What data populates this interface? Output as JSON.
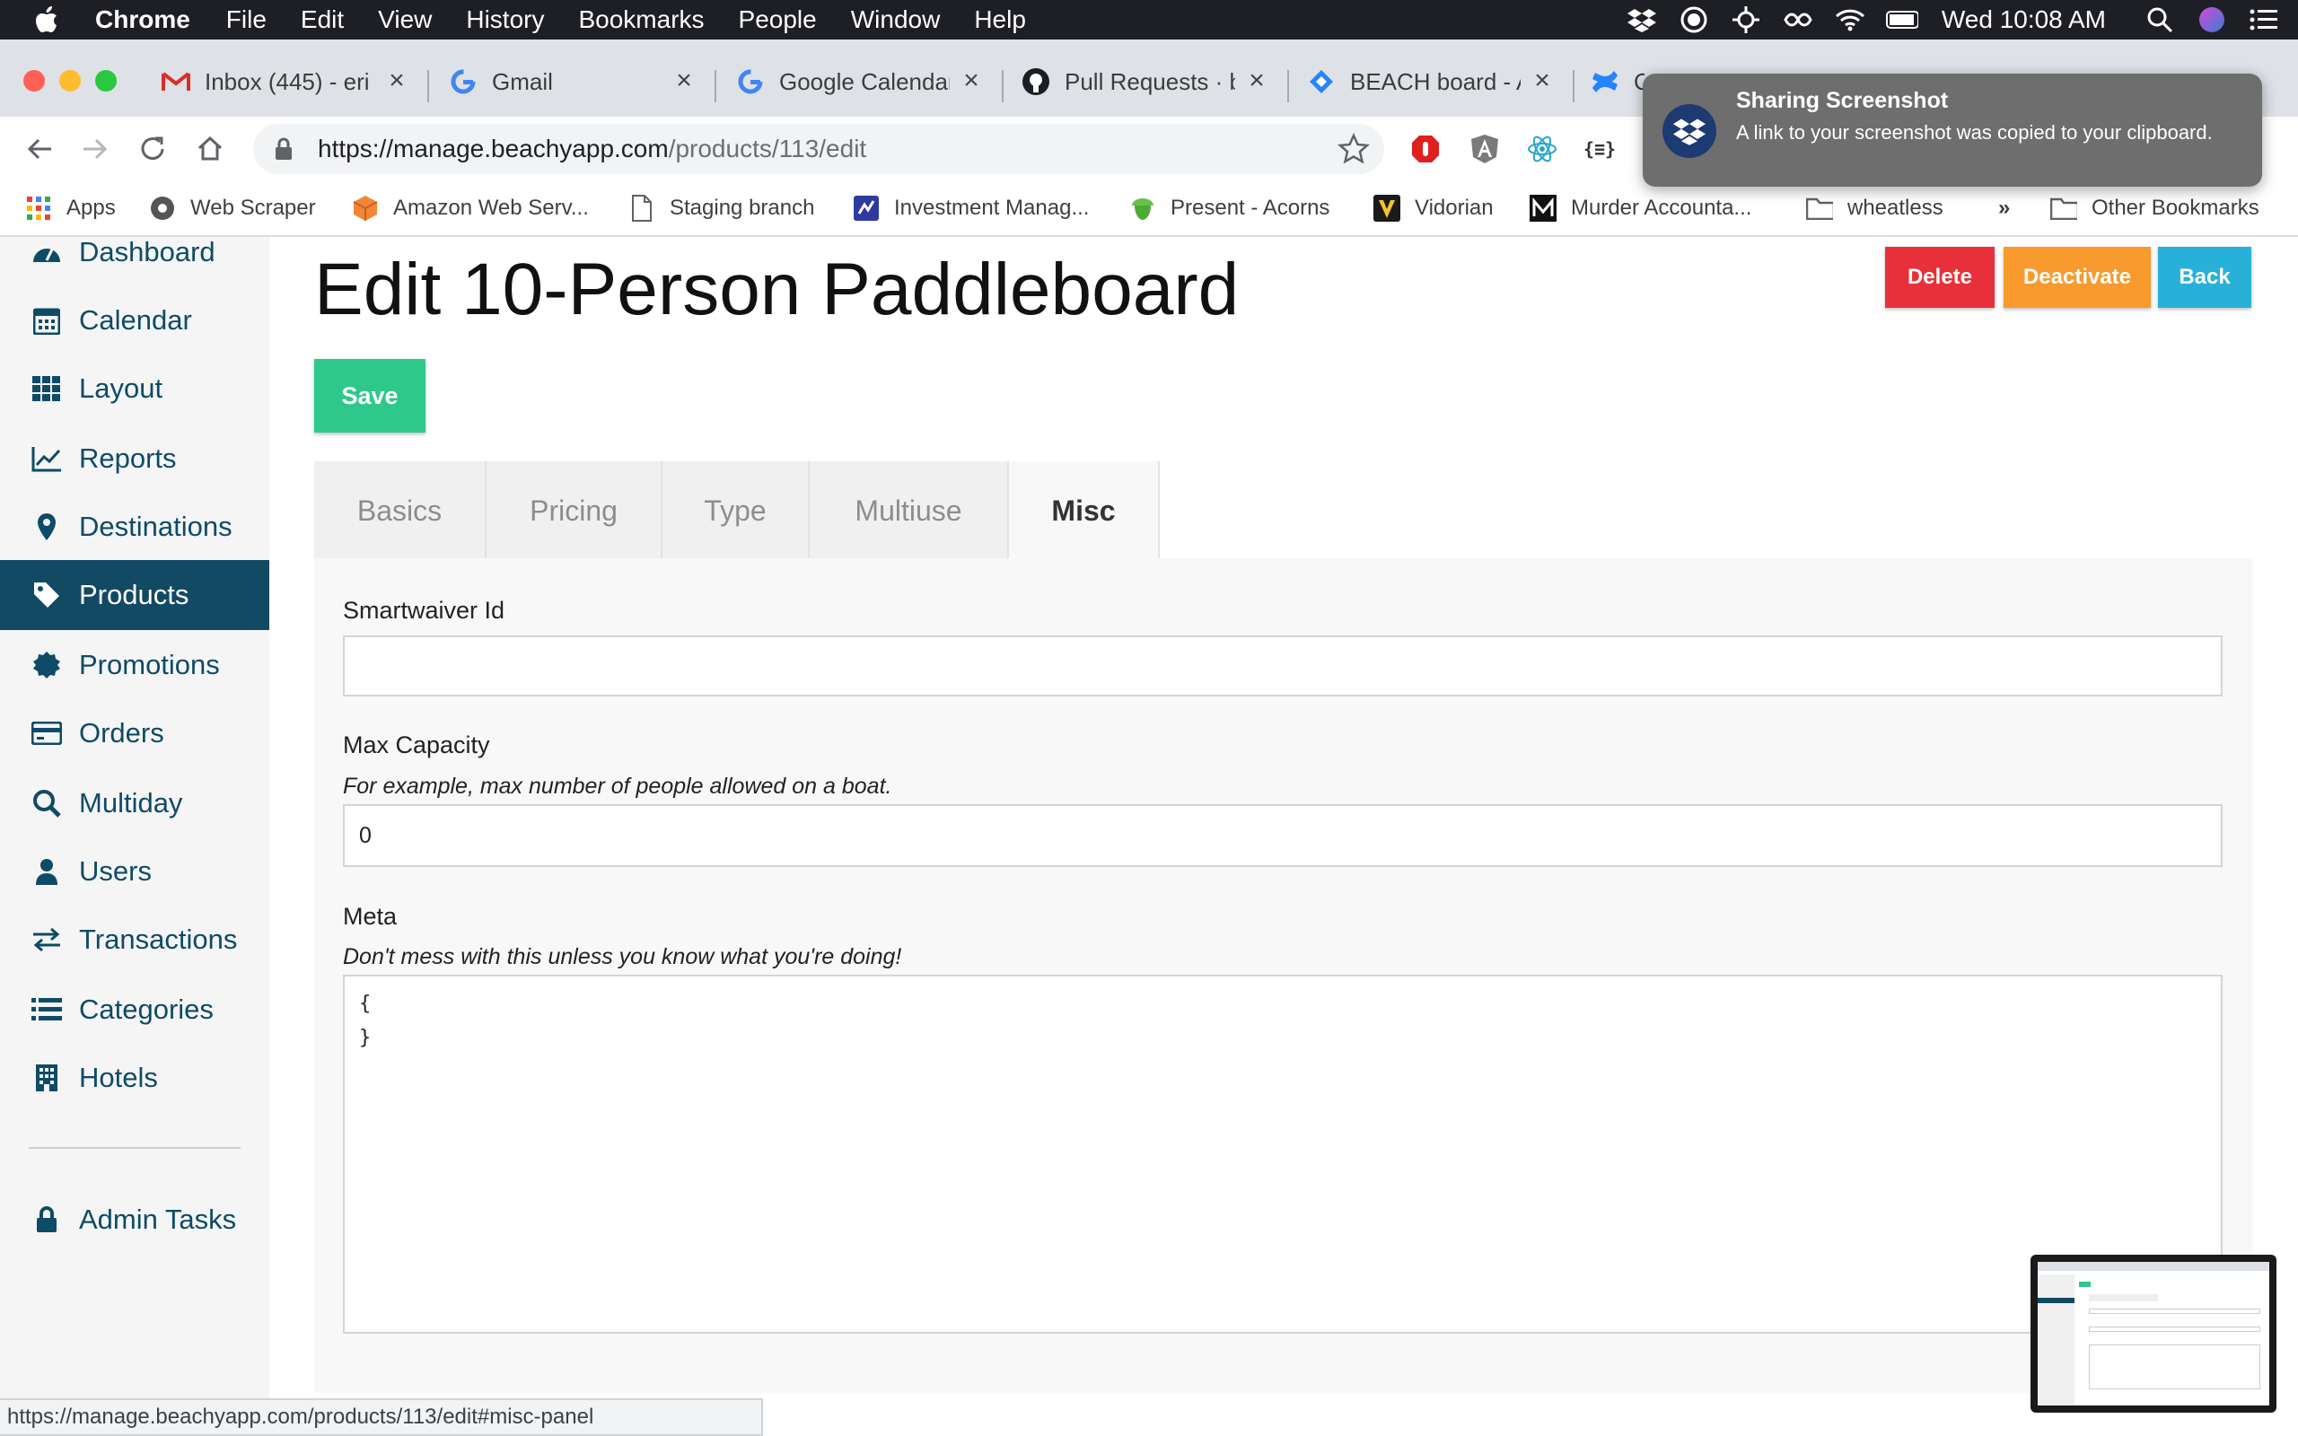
{
  "menubar": {
    "app_name": "Chrome",
    "items": [
      "File",
      "Edit",
      "View",
      "History",
      "Bookmarks",
      "People",
      "Window",
      "Help"
    ],
    "clock": "Wed 10:08 AM"
  },
  "tabs": [
    {
      "title": "Inbox (445) - eri",
      "icon": "gmail-icon"
    },
    {
      "title": "Gmail",
      "icon": "google-icon"
    },
    {
      "title": "Google Calendar",
      "icon": "google-icon"
    },
    {
      "title": "Pull Requests · b",
      "icon": "github-icon"
    },
    {
      "title": "BEACH board - A",
      "icon": "jira-icon"
    },
    {
      "title": "C",
      "icon": "confluence-icon"
    }
  ],
  "address": {
    "host": "https://manage.beachyapp.com",
    "path": "/products/113/edit"
  },
  "bookmarks": [
    "Apps",
    "Web Scraper",
    "Amazon Web Serv...",
    "Staging branch",
    "Investment Manag...",
    "Present - Acorns",
    "Vidorian",
    "Murder Accounta...",
    "wheatless",
    "»",
    "Other Bookmarks"
  ],
  "sidebar": {
    "items": [
      {
        "label": "Dashboard",
        "icon": "dashboard-icon"
      },
      {
        "label": "Calendar",
        "icon": "calendar-icon"
      },
      {
        "label": "Layout",
        "icon": "grid-icon"
      },
      {
        "label": "Reports",
        "icon": "chart-icon"
      },
      {
        "label": "Destinations",
        "icon": "map-marker-icon"
      },
      {
        "label": "Products",
        "icon": "tag-icon",
        "active": true
      },
      {
        "label": "Promotions",
        "icon": "badge-icon"
      },
      {
        "label": "Orders",
        "icon": "credit-card-icon"
      },
      {
        "label": "Multiday",
        "icon": "search-icon"
      },
      {
        "label": "Users",
        "icon": "user-icon"
      },
      {
        "label": "Transactions",
        "icon": "exchange-icon"
      },
      {
        "label": "Categories",
        "icon": "list-icon"
      },
      {
        "label": "Hotels",
        "icon": "building-icon"
      }
    ],
    "admin": {
      "label": "Admin Tasks",
      "icon": "lock-icon"
    }
  },
  "main": {
    "title": "Edit 10-Person Paddleboard",
    "save_label": "Save",
    "actions": {
      "delete": "Delete",
      "deactivate": "Deactivate",
      "back": "Back"
    },
    "tabs": [
      "Basics",
      "Pricing",
      "Type",
      "Multiuse",
      "Misc"
    ],
    "active_tab": "Misc",
    "fields": {
      "smartwaiver": {
        "label": "Smartwaiver Id",
        "value": ""
      },
      "max_capacity": {
        "label": "Max Capacity",
        "hint": "For example, max number of people allowed on a boat.",
        "value": "0"
      },
      "meta": {
        "label": "Meta",
        "hint": "Don't mess with this unless you know what you're doing!",
        "value": "{\n}"
      }
    }
  },
  "status_url": "https://manage.beachyapp.com/products/113/edit#misc-panel",
  "notification": {
    "title": "Sharing Screenshot",
    "body": "A link to your screenshot was copied to your clipboard."
  },
  "colors": {
    "sidebar_active": "#124a63",
    "save": "#2ec98a",
    "delete": "#e8303a",
    "deactivate": "#f89a2d",
    "back": "#28b1d8"
  }
}
